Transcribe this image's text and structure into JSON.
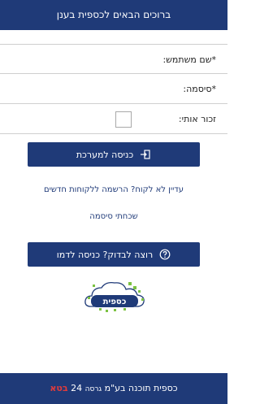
{
  "header": {
    "title": "ברוכים הבאים לכספית בענן"
  },
  "form": {
    "username_label": "*שם משתמש:",
    "password_label": "*סיסמה:",
    "remember_label": "זכור אותי:"
  },
  "buttons": {
    "login_label": "כניסה למערכת",
    "demo_label": "רוצה לבדוק? כניסה לדמו"
  },
  "links": {
    "register": "עדיין לא לקוח? הרשמה ללקוחות חדשים",
    "forgot_password": "שכחתי סיסמה"
  },
  "logo": {
    "text": "כספית"
  },
  "footer": {
    "company": "כספית תוכנה בע\"מ",
    "version_label": "גרסה",
    "version_number": "24",
    "beta": "בטא"
  },
  "colors": {
    "primary": "#1f3a78",
    "beta": "#e23b3b"
  }
}
